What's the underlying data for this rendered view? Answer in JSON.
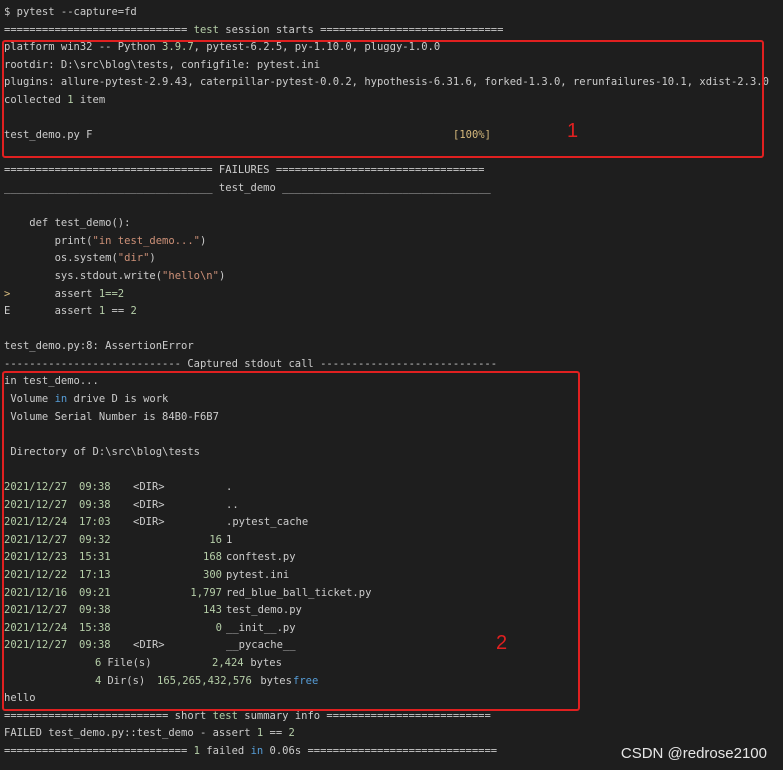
{
  "terminal": {
    "command_line": "$ pytest --capture=fd",
    "session_header_left": "============================= ",
    "session_header_word1": "test",
    "session_header_right": " session starts =============================",
    "platform_prefix": "platform win32 -- Python ",
    "platform_version": "3.9.7",
    "platform_suffix": ", pytest-6.2.5, py-1.10.0, pluggy-1.0.0",
    "rootdir": "rootdir: D:\\src\\blog\\tests, configfile: pytest.ini",
    "plugins": "plugins: allure-pytest-2.9.43, caterpillar-pytest-0.0.2, hypothesis-6.31.6, forked-1.3.0, rerunfailures-10.1, xdist-2.3.0",
    "collected_prefix": "collected ",
    "collected_count": "1",
    "collected_suffix": " item",
    "test_file_line": "test_demo.py F",
    "progress": "[100%]",
    "failures_header": "================================= FAILURES =================================",
    "test_header": "_________________________________ test_demo _________________________________",
    "code": {
      "def_line": "    def test_demo():",
      "print_pre": "        print(",
      "print_str": "\"in test_demo...\"",
      "print_post": ")",
      "ossys_pre": "        os.system(",
      "ossys_str": "\"dir\"",
      "ossys_post": ")",
      "write_pre": "        sys.stdout.write(",
      "write_str": "\"hello\\n\"",
      "write_post": ")",
      "assert1_marker": ">",
      "assert1_pre": "       assert ",
      "assert1_expr": "1==2",
      "assert2_marker": "E",
      "assert2_pre": "       assert ",
      "assert2_a": "1",
      "assert2_op": " == ",
      "assert2_b": "2"
    },
    "error_line": "test_demo.py:8: AssertionError",
    "captured_header": "---------------------------- Captured stdout call ----------------------------",
    "stdout": {
      "l1": "in test_demo...",
      "l2_pre": " Volume ",
      "l2_kw": "in",
      "l2_post": " drive D is work",
      "l3": " Volume Serial Number is 84B0-F6B7",
      "l4": " Directory of D:\\src\\blog\\tests",
      "entries": [
        {
          "date": "2021/12/27",
          "time": "09:38",
          "dir": "<DIR>",
          "size": "",
          "name": "."
        },
        {
          "date": "2021/12/27",
          "time": "09:38",
          "dir": "<DIR>",
          "size": "",
          "name": ".."
        },
        {
          "date": "2021/12/24",
          "time": "17:03",
          "dir": "<DIR>",
          "size": "",
          "name": ".pytest_cache"
        },
        {
          "date": "2021/12/27",
          "time": "09:32",
          "dir": "",
          "size": "16",
          "name": "1"
        },
        {
          "date": "2021/12/23",
          "time": "15:31",
          "dir": "",
          "size": "168",
          "name": "conftest.py"
        },
        {
          "date": "2021/12/22",
          "time": "17:13",
          "dir": "",
          "size": "300",
          "name": "pytest.ini"
        },
        {
          "date": "2021/12/16",
          "time": "09:21",
          "dir": "",
          "size": "1,797",
          "name": "red_blue_ball_ticket.py"
        },
        {
          "date": "2021/12/27",
          "time": "09:38",
          "dir": "",
          "size": "143",
          "name": "test_demo.py"
        },
        {
          "date": "2021/12/24",
          "time": "15:38",
          "dir": "",
          "size": "0",
          "name": "__init__.py"
        },
        {
          "date": "2021/12/27",
          "time": "09:38",
          "dir": "<DIR>",
          "size": "",
          "name": "__pycache__"
        }
      ],
      "files_count": "6",
      "files_label": " File(s)",
      "files_bytes": "2,424",
      "files_bytes_label": " bytes",
      "dirs_count": "4",
      "dirs_label": " Dir(s)",
      "dirs_bytes": "165,265,432,576",
      "dirs_bytes_label": " bytes ",
      "dirs_free": "free",
      "hello": "hello"
    },
    "summary_header_left": "========================== short ",
    "summary_header_kw": "test",
    "summary_header_right": " summary info ==========================",
    "failed_line_pre": "FAILED test_demo.py::test_demo - assert ",
    "failed_a": "1",
    "failed_op": " == ",
    "failed_b": "2",
    "final_left": "============================= ",
    "final_count": "1",
    "final_mid": " failed ",
    "final_in": "in",
    "final_time": " 0.06s",
    "final_right": " =============================="
  },
  "annotations": {
    "box1_label": "1",
    "box2_label": "2",
    "color": "#e02020"
  },
  "watermark": "CSDN @redrose2100"
}
